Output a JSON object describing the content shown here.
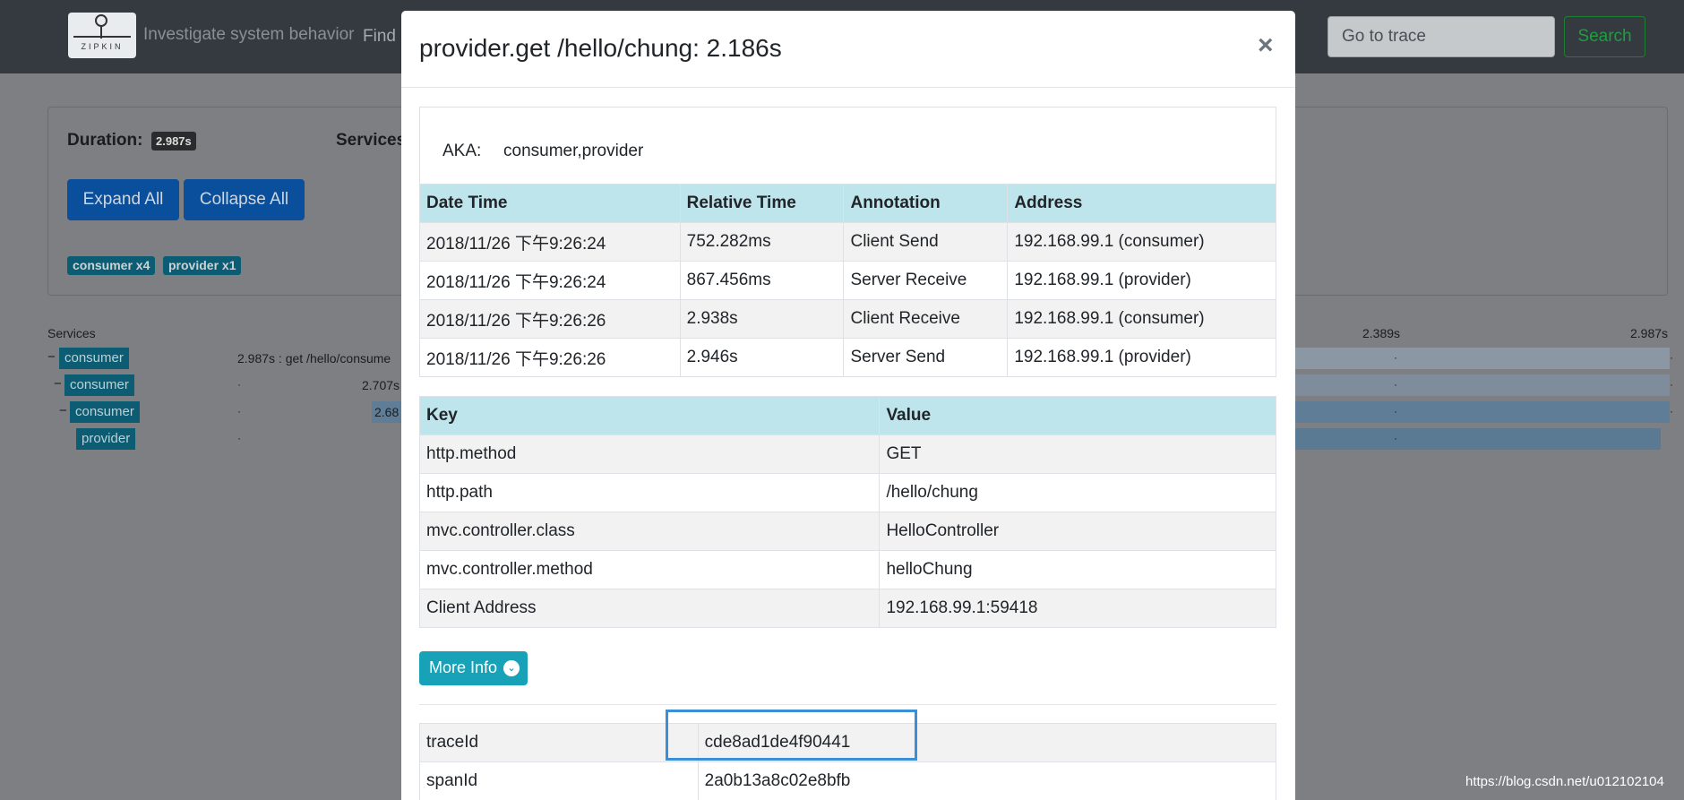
{
  "navbar": {
    "logo_text": "ZIPKIN",
    "tagline": "Investigate system behavior",
    "find": "Find",
    "goto_placeholder": "Go to trace",
    "search_label": "Search"
  },
  "summary": {
    "duration_label": "Duration:",
    "duration_value": "2.987s",
    "services_label": "Services",
    "expand_all": "Expand All",
    "collapse_all": "Collapse All",
    "badges": [
      "consumer x4",
      "provider x1"
    ]
  },
  "timeline": {
    "services_header": "Services",
    "axis_ticks": [
      "2.389s",
      "2.987s"
    ],
    "rows": [
      {
        "service": "consumer",
        "duration_text": "2.987s : get /hello/consume"
      },
      {
        "service": "consumer",
        "duration_text": "2.707s"
      },
      {
        "service": "consumer",
        "duration_text": "2.68"
      },
      {
        "service": "provider",
        "duration_text": ""
      }
    ]
  },
  "modal": {
    "title": "provider.get /hello/chung: 2.186s",
    "close": "×",
    "aka_label": "AKA:",
    "aka_value": "consumer,provider",
    "annotations": {
      "headers": [
        "Date Time",
        "Relative Time",
        "Annotation",
        "Address"
      ],
      "rows": [
        [
          "2018/11/26 下午9:26:24",
          "752.282ms",
          "Client Send",
          "192.168.99.1 (consumer)"
        ],
        [
          "2018/11/26 下午9:26:24",
          "867.456ms",
          "Server Receive",
          "192.168.99.1 (provider)"
        ],
        [
          "2018/11/26 下午9:26:26",
          "2.938s",
          "Client Receive",
          "192.168.99.1 (consumer)"
        ],
        [
          "2018/11/26 下午9:26:26",
          "2.946s",
          "Server Send",
          "192.168.99.1 (provider)"
        ]
      ]
    },
    "tags": {
      "headers": [
        "Key",
        "Value"
      ],
      "rows": [
        [
          "http.method",
          "GET"
        ],
        [
          "http.path",
          "/hello/chung"
        ],
        [
          "mvc.controller.class",
          "HelloController"
        ],
        [
          "mvc.controller.method",
          "helloChung"
        ],
        [
          "Client Address",
          "192.168.99.1:59418"
        ]
      ]
    },
    "more_info": "More Info",
    "ids": {
      "rows": [
        [
          "traceId",
          "cde8ad1de4f90441"
        ],
        [
          "spanId",
          "2a0b13a8c02e8bfb"
        ]
      ]
    }
  },
  "watermark": "https://blog.csdn.net/u012102104"
}
